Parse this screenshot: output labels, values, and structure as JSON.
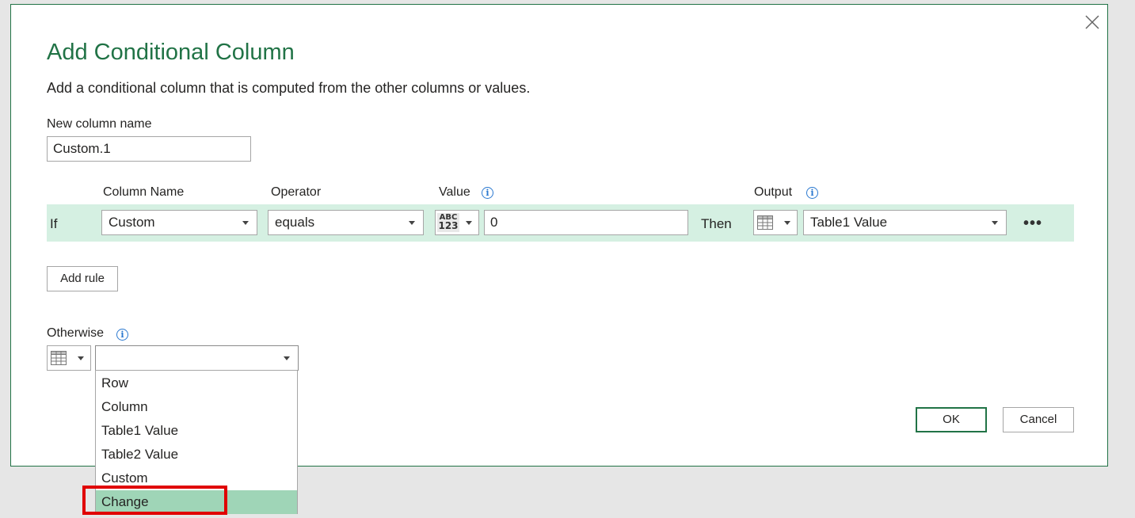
{
  "dialog": {
    "title": "Add Conditional Column",
    "subtitle": "Add a conditional column that is computed from the other columns or values.",
    "close_icon": "close-icon"
  },
  "new_column": {
    "label": "New column name",
    "value": "Custom.1"
  },
  "rule_headers": {
    "column_name": "Column Name",
    "operator": "Operator",
    "value": "Value",
    "output": "Output"
  },
  "rule": {
    "if_label": "If",
    "column_name": "Custom",
    "operator": "equals",
    "value_type_icon_top": "ABC",
    "value_type_icon_bottom": "123",
    "value": "0",
    "then_label": "Then",
    "output_type_icon": "table-icon",
    "output": "Table1 Value",
    "more_icon": "ellipsis-icon",
    "more_label": "•••"
  },
  "add_rule_label": "Add rule",
  "otherwise": {
    "label": "Otherwise",
    "type_icon": "table-icon",
    "value": "",
    "options": [
      "Row",
      "Column",
      "Table1 Value",
      "Table2 Value",
      "Custom",
      "Change"
    ],
    "selected_option": "Change"
  },
  "info_glyph": "i",
  "buttons": {
    "ok": "OK",
    "cancel": "Cancel"
  },
  "colors": {
    "accent": "#217346",
    "rule_row_bg": "#d5f0e2",
    "selected_option_bg": "#9fd5b7",
    "highlight": "#e00000"
  }
}
